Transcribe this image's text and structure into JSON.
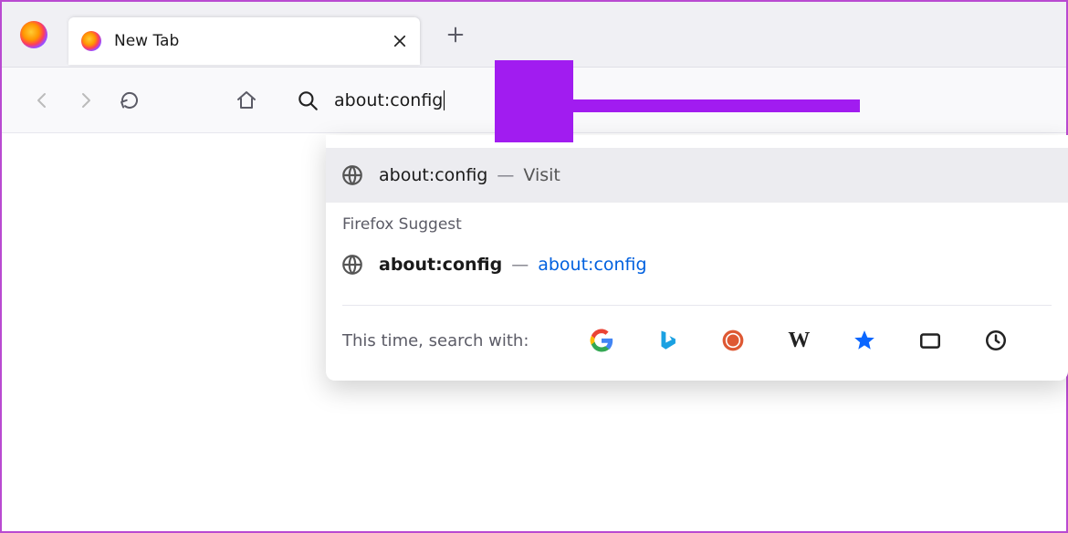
{
  "tab": {
    "title": "New Tab"
  },
  "urlbar": {
    "text": "about:config"
  },
  "suggestions": {
    "section_label": "Firefox Suggest",
    "row1": {
      "text": "about:config",
      "action": "Visit"
    },
    "row2": {
      "text": "about:config",
      "hint": "about:config"
    }
  },
  "search_engines": {
    "label": "This time, search with:",
    "items": [
      "Google",
      "Bing",
      "DuckDuckGo",
      "Wikipedia",
      "Bookmarks",
      "Tabs",
      "History"
    ]
  },
  "annotation_color": "#a11cf0"
}
